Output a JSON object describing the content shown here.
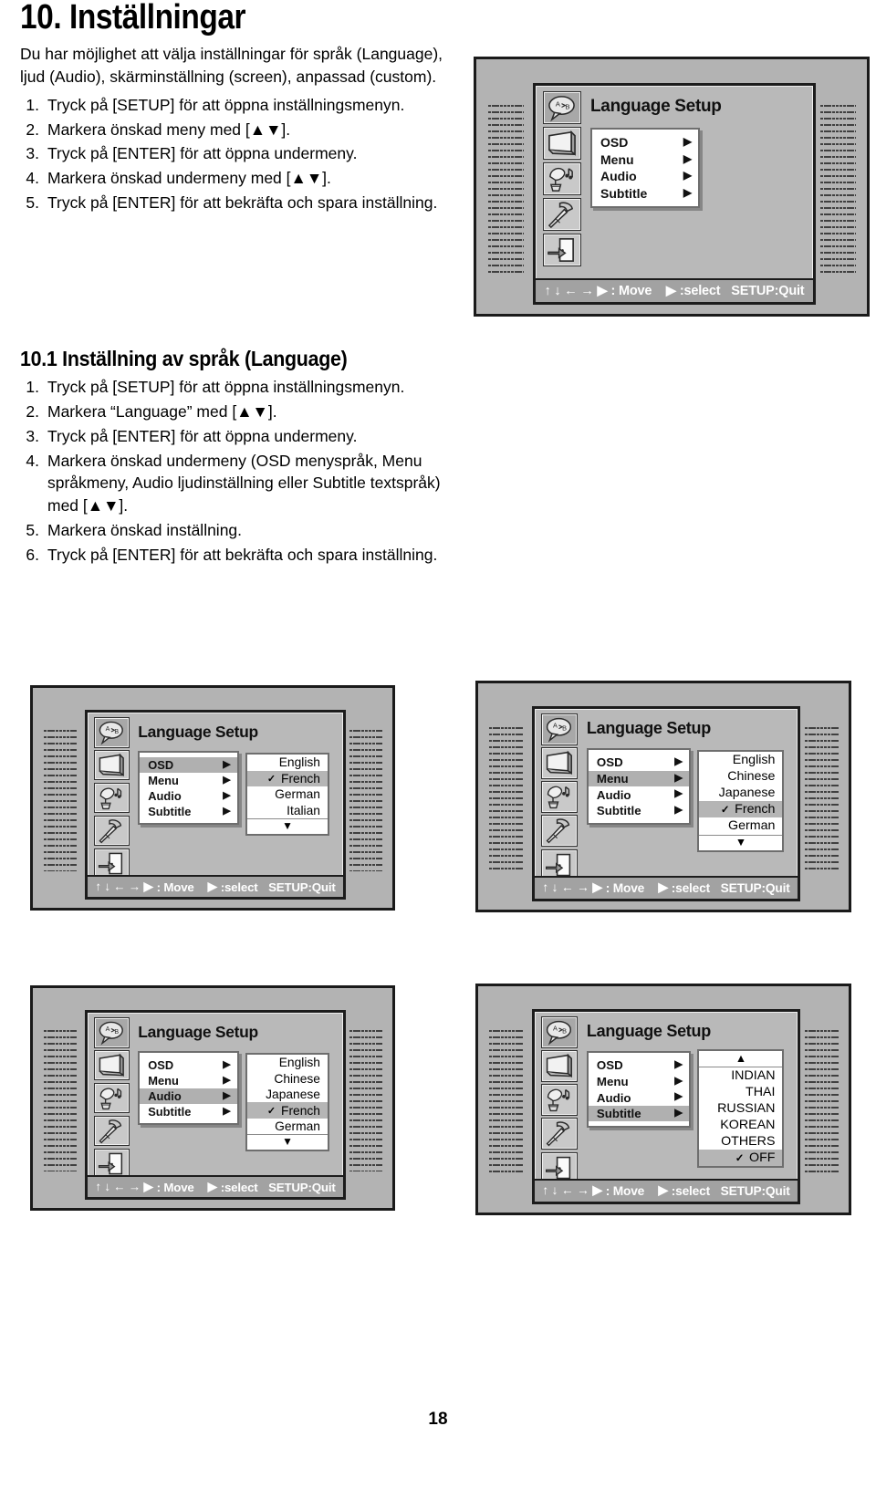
{
  "page": {
    "number": "18",
    "heading": "10. Inställningar"
  },
  "intro": {
    "paragraph": "Du har möjlighet att välja inställningar för språk (Language), ljud (Audio), skärminställning (screen), anpassad (custom).",
    "steps": [
      {
        "num": "1.",
        "text": "Tryck på [SETUP] för att öppna inställningsmenyn."
      },
      {
        "num": "2.",
        "text": "Markera önskad meny med [▲▼]."
      },
      {
        "num": "3.",
        "text": "Tryck på [ENTER] för att öppna undermeny."
      },
      {
        "num": "4.",
        "text": "Markera önskad undermeny med [▲▼]."
      },
      {
        "num": "5.",
        "text": "Tryck på [ENTER] för att bekräfta och spara inställning."
      }
    ]
  },
  "section101": {
    "heading": "10.1 Inställning av språk (Language)",
    "steps": [
      {
        "num": "1.",
        "text": "Tryck på [SETUP] för att öppna inställningsmenyn."
      },
      {
        "num": "2.",
        "text": "Markera “Language” med [▲▼]."
      },
      {
        "num": "3.",
        "text": "Tryck på [ENTER] för att öppna undermeny."
      },
      {
        "num": "4.",
        "text": "Markera önskad undermeny (OSD menyspråk, Menu språkmeny, Audio ljudinställning eller Subtitle textspråk) med [▲▼]."
      },
      {
        "num": "5.",
        "text": "Markera önskad inställning."
      },
      {
        "num": "6.",
        "text": "Tryck på [ENTER] för att bekräfta och spara inställning."
      }
    ]
  },
  "osd_common": {
    "title": "Language Setup",
    "menu_items": [
      "OSD",
      "Menu",
      "Audio",
      "Subtitle"
    ],
    "caret_glyph": "▶",
    "check_glyph": "✓",
    "down_glyph": "▼",
    "up_glyph": "▲",
    "hint": {
      "move_glyphs": "↑ ↓ ← → ▶",
      "move_label": ": Move",
      "select_glyph": "▶",
      "select_label": ":select",
      "quit_label": "SETUP:Quit"
    },
    "rail_icons": [
      "language-speech-icon",
      "screen-tv-icon",
      "audio-gramophone-icon",
      "custom-hammer-icon",
      "exit-door-icon"
    ]
  },
  "figures": [
    {
      "id": "figure-language-setup-root",
      "selected_menu": null,
      "values": null,
      "value_scroll": null
    },
    {
      "id": "figure-osd-language-list",
      "selected_menu": "OSD",
      "values": [
        {
          "label": "English",
          "checked": false,
          "selected": false
        },
        {
          "label": "French",
          "checked": true,
          "selected": true
        },
        {
          "label": "German",
          "checked": false,
          "selected": false
        },
        {
          "label": "Italian",
          "checked": false,
          "selected": false
        }
      ],
      "value_scroll": "down"
    },
    {
      "id": "figure-menu-language-list",
      "selected_menu": "Menu",
      "values": [
        {
          "label": "English",
          "checked": false,
          "selected": false
        },
        {
          "label": "Chinese",
          "checked": false,
          "selected": false
        },
        {
          "label": "Japanese",
          "checked": false,
          "selected": false
        },
        {
          "label": "French",
          "checked": true,
          "selected": true
        },
        {
          "label": "German",
          "checked": false,
          "selected": false
        }
      ],
      "value_scroll": "down"
    },
    {
      "id": "figure-audio-language-list",
      "selected_menu": "Audio",
      "values": [
        {
          "label": "English",
          "checked": false,
          "selected": false
        },
        {
          "label": "Chinese",
          "checked": false,
          "selected": false
        },
        {
          "label": "Japanese",
          "checked": false,
          "selected": false
        },
        {
          "label": "French",
          "checked": true,
          "selected": true
        },
        {
          "label": "German",
          "checked": false,
          "selected": false
        }
      ],
      "value_scroll": "down"
    },
    {
      "id": "figure-subtitle-language-list",
      "selected_menu": "Subtitle",
      "values": [
        {
          "label": "INDIAN",
          "checked": false,
          "selected": false
        },
        {
          "label": "THAI",
          "checked": false,
          "selected": false
        },
        {
          "label": "RUSSIAN",
          "checked": false,
          "selected": false
        },
        {
          "label": "KOREAN",
          "checked": false,
          "selected": false
        },
        {
          "label": "OTHERS",
          "checked": false,
          "selected": false
        },
        {
          "label": "OFF",
          "checked": true,
          "selected": true
        }
      ],
      "value_scroll": "up"
    }
  ],
  "colors": {
    "figure_bg": "#b3b3b3",
    "osd_bg": "#b9b9b9",
    "highlight": "#b0b0b0",
    "hint_bar": "#a2a2a2",
    "panel_bg": "#ffffff"
  }
}
